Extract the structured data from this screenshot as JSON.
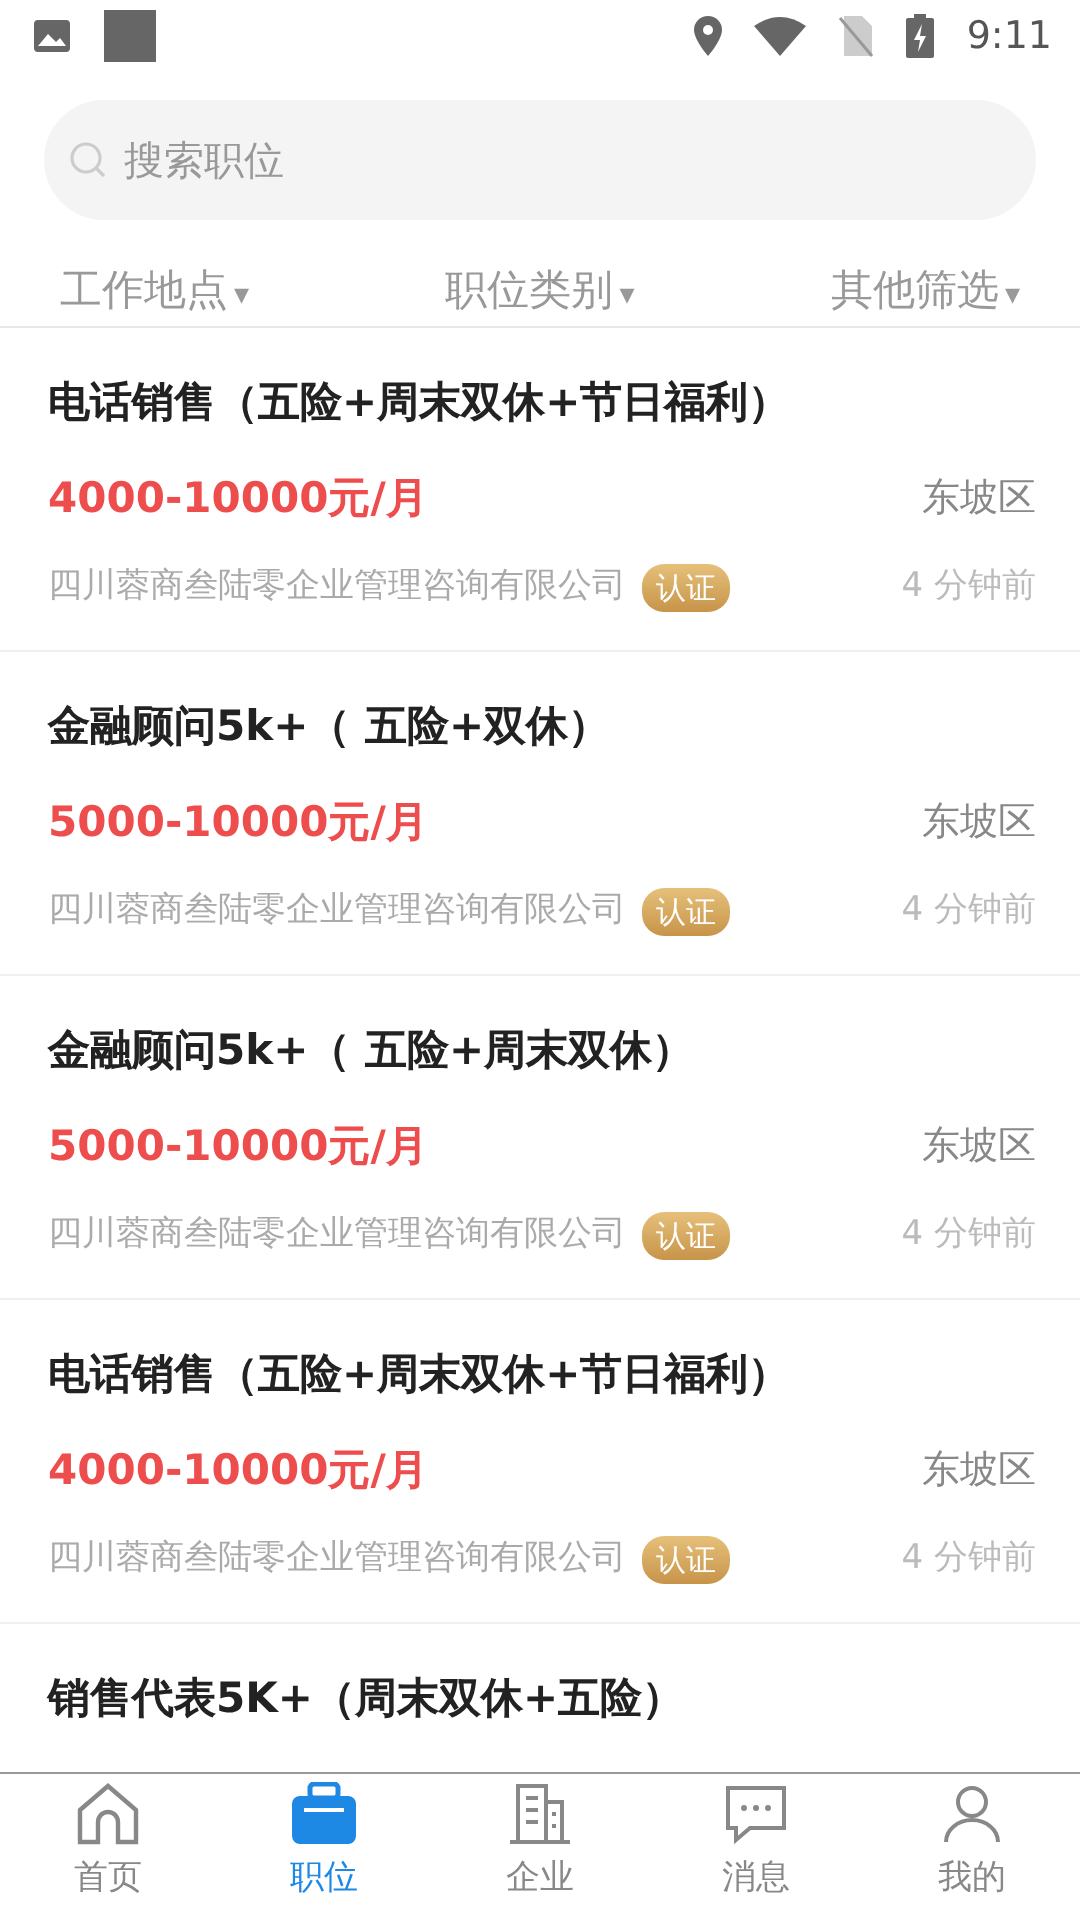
{
  "status_bar": {
    "time": "9:11"
  },
  "search": {
    "placeholder": "搜索职位"
  },
  "filters": [
    {
      "label": "工作地点",
      "caret": "▾"
    },
    {
      "label": "职位类别",
      "caret": "▾"
    },
    {
      "label": "其他筛选",
      "caret": "▾"
    }
  ],
  "jobs": [
    {
      "title": "电话销售（五险+周末双休+节日福利）",
      "salary": "4000-10000元/月",
      "district": "东坡区",
      "company": "四川蓉商叁陆零企业管理咨询有限公司",
      "badge": "认证",
      "time": "4 分钟前"
    },
    {
      "title": "金融顾问5k+（ 五险+双休）",
      "salary": "5000-10000元/月",
      "district": "东坡区",
      "company": "四川蓉商叁陆零企业管理咨询有限公司",
      "badge": "认证",
      "time": "4 分钟前"
    },
    {
      "title": "金融顾问5k+（ 五险+周末双休）",
      "salary": "5000-10000元/月",
      "district": "东坡区",
      "company": "四川蓉商叁陆零企业管理咨询有限公司",
      "badge": "认证",
      "time": "4 分钟前"
    },
    {
      "title": "电话销售（五险+周末双休+节日福利）",
      "salary": "4000-10000元/月",
      "district": "东坡区",
      "company": "四川蓉商叁陆零企业管理咨询有限公司",
      "badge": "认证",
      "time": "4 分钟前"
    },
    {
      "title": "销售代表5K+（周末双休+五险）"
    }
  ],
  "bottom_nav": [
    {
      "label": "首页",
      "kind": "home",
      "selected": false
    },
    {
      "label": "职位",
      "kind": "jobs",
      "selected": true
    },
    {
      "label": "企业",
      "kind": "company",
      "selected": false
    },
    {
      "label": "消息",
      "kind": "message",
      "selected": false
    },
    {
      "label": "我的",
      "kind": "profile",
      "selected": false
    }
  ]
}
